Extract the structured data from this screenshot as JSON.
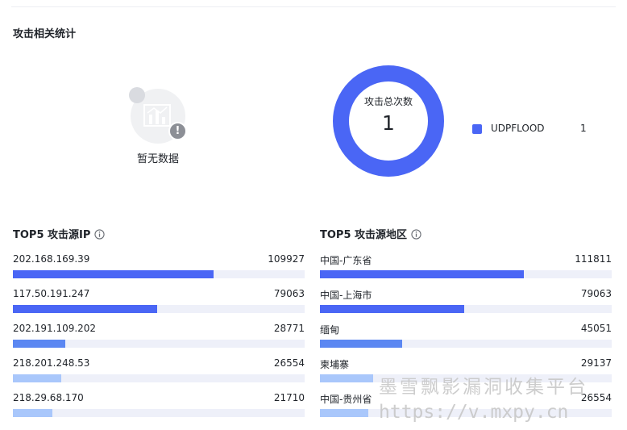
{
  "section_title": "攻击相关统计",
  "empty_state": {
    "text": "暂无数据",
    "warn_symbol": "!"
  },
  "donut": {
    "label": "攻击总次数",
    "value": "1",
    "color": "#4a66f5"
  },
  "legend": [
    {
      "name": "UDPFLOOD",
      "count": "1",
      "color": "#4a66f5"
    }
  ],
  "top_ip": {
    "title": "TOP5 攻击源IP",
    "max": 160000,
    "items": [
      {
        "name": "202.168.169.39",
        "value": 109927
      },
      {
        "name": "117.50.191.247",
        "value": 79063
      },
      {
        "name": "202.191.109.202",
        "value": 28771
      },
      {
        "name": "218.201.248.53",
        "value": 26554
      },
      {
        "name": "218.29.68.170",
        "value": 21710
      }
    ]
  },
  "top_region": {
    "title": "TOP5 攻击源地区",
    "max": 160000,
    "items": [
      {
        "name": "中国-广东省",
        "value": 111811
      },
      {
        "name": "中国-上海市",
        "value": 79063
      },
      {
        "name": "缅甸",
        "value": 45051
      },
      {
        "name": "柬埔寨",
        "value": 29137
      },
      {
        "name": "中国-贵州省",
        "value": 26554
      }
    ]
  },
  "bar_colors": [
    "#4a66f5",
    "#4a66f5",
    "#5b87f2",
    "#a9c7fb",
    "#a9c7fb"
  ],
  "watermark": {
    "line1": "墨雪飘影漏洞收集平台",
    "line2": "https://v.mxpy.cn"
  }
}
